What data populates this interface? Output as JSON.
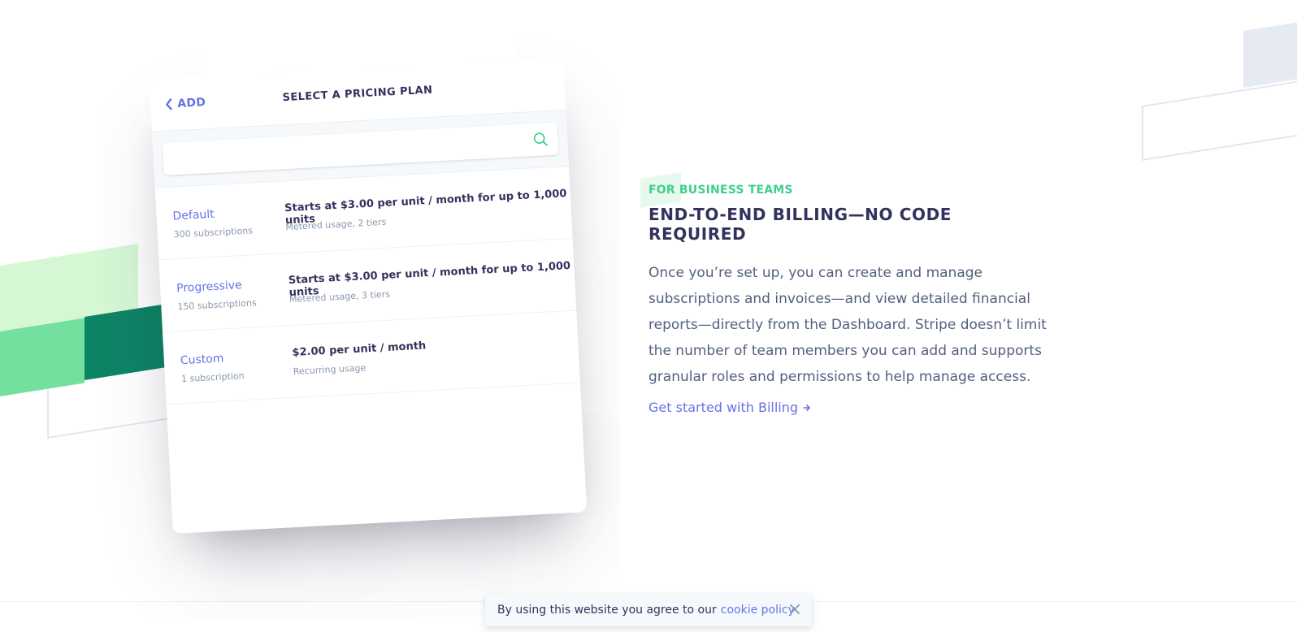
{
  "card": {
    "back_label": "ADD",
    "title": "SELECT A PRICING PLAN",
    "search": {
      "value": "",
      "placeholder": ""
    },
    "plans": [
      {
        "name": "Default",
        "subscriptions": "300 subscriptions",
        "price": "Starts at $3.00 per unit / month for up to 1,000 units",
        "usage": "Metered usage, 2 tiers"
      },
      {
        "name": "Progressive",
        "subscriptions": "150 subscriptions",
        "price": "Starts at $3.00 per unit / month for up to 1,000 units",
        "usage": "Metered usage, 3 tiers"
      },
      {
        "name": "Custom",
        "subscriptions": "1 subscription",
        "price": "$2.00 per unit / month",
        "usage": "Recurring usage"
      }
    ]
  },
  "section": {
    "eyebrow": "FOR BUSINESS TEAMS",
    "headline": "END-TO-END BILLING—NO CODE REQUIRED",
    "body_lines": [
      "Once you’re set up, you can create and manage",
      "subscriptions and invoices—and view detailed financial",
      "reports—directly from the Dashboard. Stripe doesn’t limit",
      "the number of team members you can add and supports",
      "granular roles and permissions to help manage access."
    ],
    "cta_label": "Get started with Billing"
  },
  "cookie_banner": {
    "text": "By using this website you agree to our",
    "link_label": "cookie policy"
  },
  "colors": {
    "accent": "#6772e5",
    "green": "#3ecf8e",
    "dark_green": "#0e8466",
    "heading": "#32325d",
    "body": "#525f7f"
  },
  "icons": {
    "back": "chevron-left-icon",
    "search": "search-icon",
    "cta_arrow": "arrow-right-icon",
    "close": "close-icon"
  }
}
